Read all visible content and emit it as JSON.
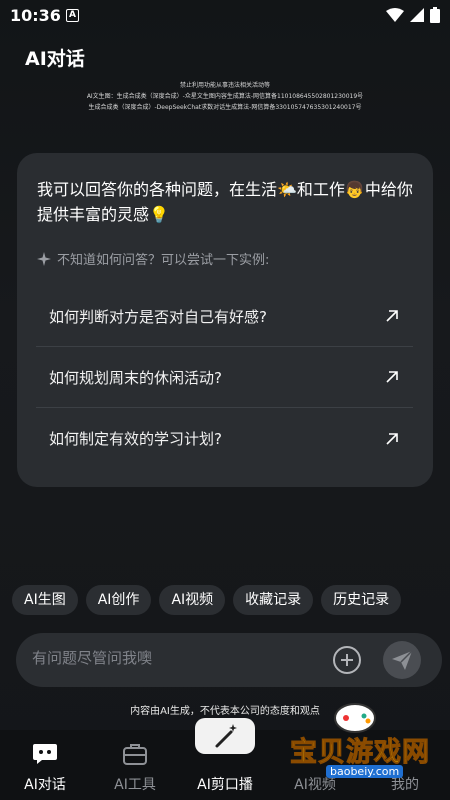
{
  "status_bar": {
    "time": "10:36",
    "notification_glyph": "A"
  },
  "header": {
    "title": "AI对话"
  },
  "notice_lines": [
    "禁止利用功能从事违法相关活动等",
    "AI文生图：生成合成类（深度合成）-众星文生图内容生成算法-网信算备110108645502801230019号",
    "生成合成类（深度合成）-DeepSeekChat求数对话生成算法-网信算备330105747635301240017号"
  ],
  "card": {
    "greeting": "我可以回答你的各种问题，在生活🌤️和工作👦中给你提供丰富的灵感💡",
    "hint": "不知道如何问答？可以尝试一下实例:",
    "questions": [
      "如何判断对方是否对自己有好感?",
      "如何规划周末的休闲活动?",
      "如何制定有效的学习计划?"
    ]
  },
  "chips": [
    "AI生图",
    "AI创作",
    "AI视频",
    "收藏记录",
    "历史记录"
  ],
  "input": {
    "placeholder": "有问题尽管问我噢"
  },
  "disclaimer": "内容由AI生成，不代表本公司的态度和观点",
  "tabs": [
    {
      "label": "AI对话",
      "icon": "chat-bubble-icon",
      "active": true
    },
    {
      "label": "AI工具",
      "icon": "toolbox-icon",
      "active": false
    },
    {
      "label": "AI剪口播",
      "icon": "magic-wand-icon",
      "active": false
    },
    {
      "label": "AI视频",
      "icon": "video-icon",
      "active": false
    },
    {
      "label": "我的",
      "icon": "profile-icon",
      "active": false
    }
  ],
  "watermark": {
    "brand": "宝贝游戏网",
    "url": "baobeiy.com"
  },
  "colors": {
    "background": "#141619",
    "card": "#2a2d31",
    "chip": "#2b2e32",
    "watermark_yellow": "#f5c700"
  }
}
